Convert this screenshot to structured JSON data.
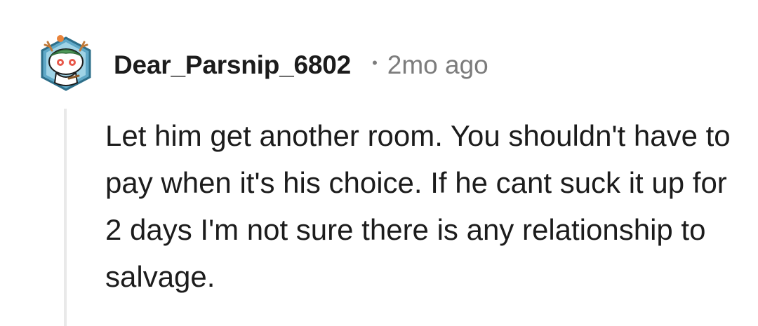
{
  "comment": {
    "avatar_icon": "reddit-snoo-avatar-icon",
    "username": "Dear_Parsnip_6802",
    "separator": "•",
    "timestamp": "2mo ago",
    "body": "Let him get another room. You shouldn't have to pay when it's his choice. If he cant suck it up for 2 days I'm not sure there is any relationship to salvage."
  },
  "colors": {
    "text": "#1c1c1c",
    "meta": "#7c7c7c",
    "thread_line": "#e9e9e9"
  }
}
